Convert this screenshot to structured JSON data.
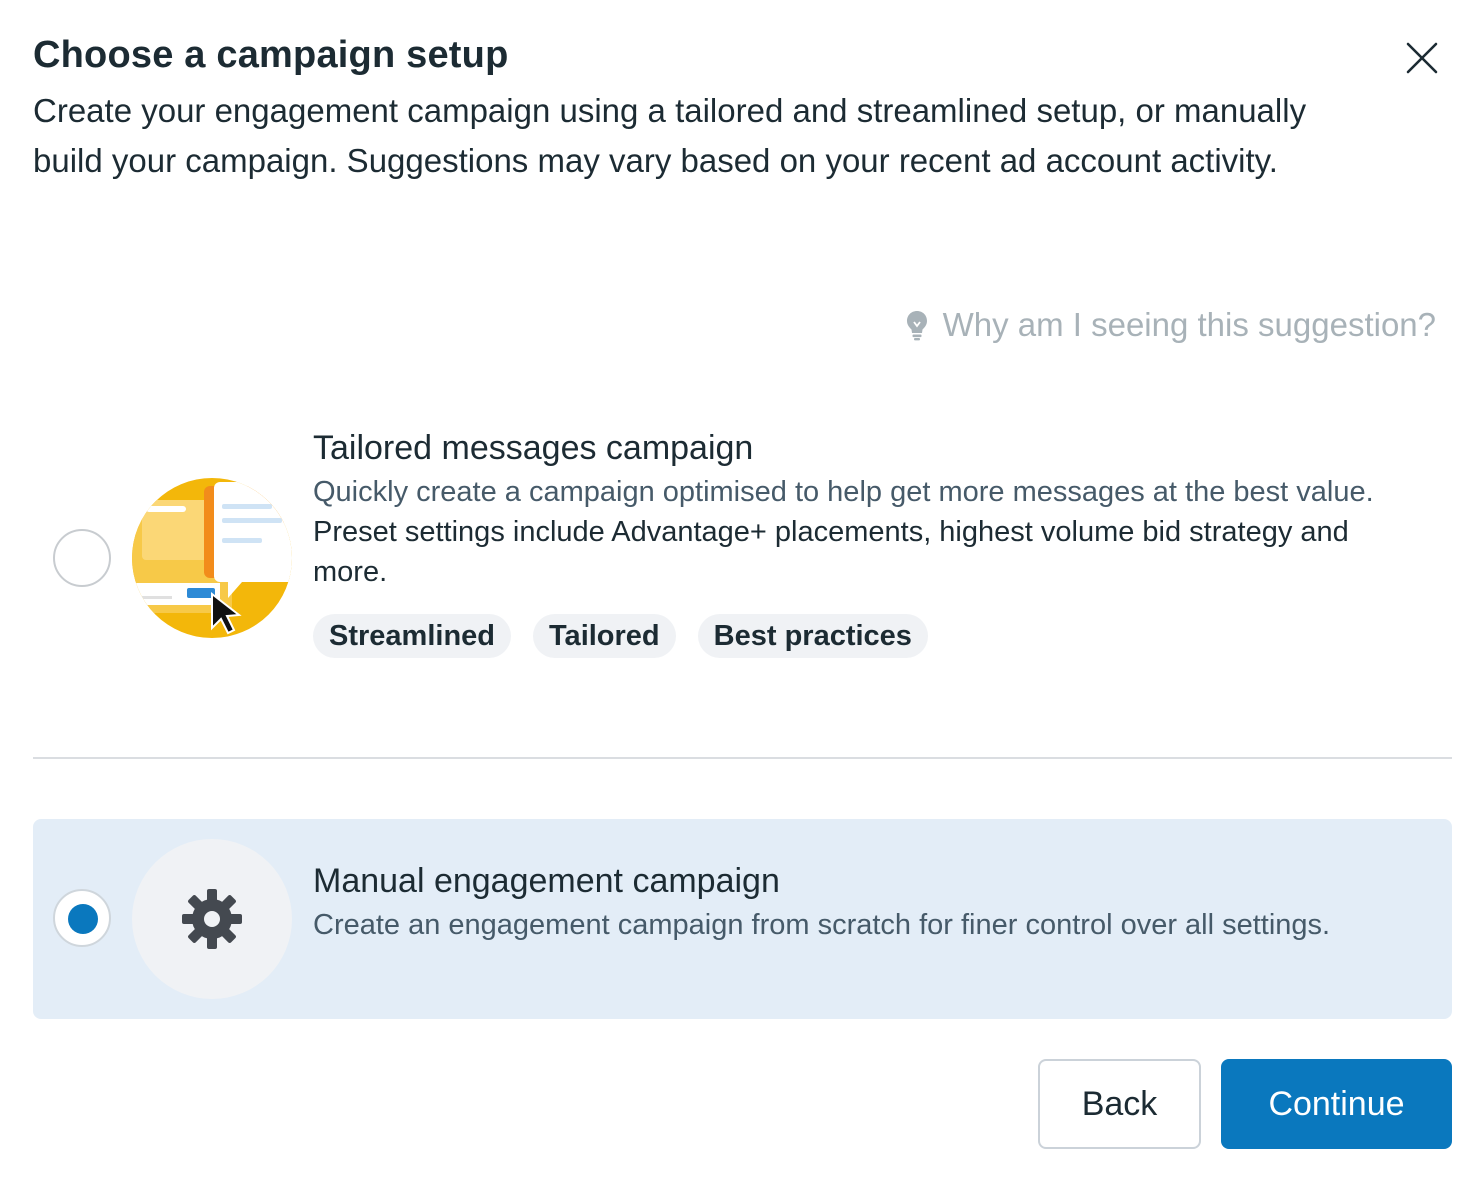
{
  "dialog": {
    "title": "Choose a campaign setup",
    "subtitle": "Create your engagement campaign using a tailored and streamlined setup, or manually build your campaign. Suggestions may vary based on your recent ad account activity.",
    "close_icon": "close-icon"
  },
  "suggestion_link": {
    "icon": "lightbulb-icon",
    "label": "Why am I seeing this suggestion?"
  },
  "options": [
    {
      "title": "Tailored messages campaign",
      "description": "Quickly create a campaign optimised to help get more messages at the best value.",
      "description_2": "Preset settings include Advantage+ placements, highest volume bid strategy and more.",
      "tags": [
        "Streamlined",
        "Tailored",
        "Best practices"
      ],
      "selected": false,
      "icon": "tailored-messages-illustration"
    },
    {
      "title": "Manual engagement campaign",
      "description": "Create an engagement campaign from scratch for finer control over all settings.",
      "selected": true,
      "icon": "gear-icon"
    }
  ],
  "footer": {
    "back_label": "Back",
    "continue_label": "Continue"
  },
  "colors": {
    "primary": "#0a78be",
    "selected_background": "#e3edf7",
    "text": "#1c2b33",
    "muted_text": "#465a69",
    "tag_background": "#f0f2f5"
  }
}
